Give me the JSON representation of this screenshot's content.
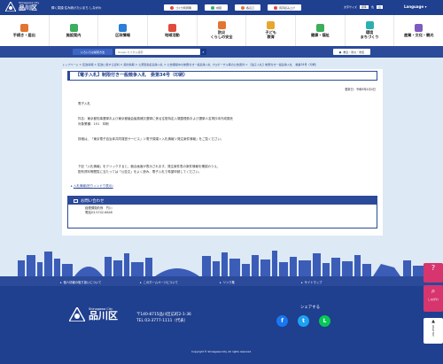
{
  "header": {
    "logo_sub": "Shinagawa City",
    "logo_main": "品川区",
    "tagline": "輝く笑顔 住み続けたいまち しながわ",
    "top_links": [
      {
        "label": "ゴミ分別辞典",
        "icon": "trash-icon",
        "color": "#e24a3b"
      },
      {
        "label": "地図",
        "icon": "map-icon",
        "color": "#3cae5c"
      },
      {
        "label": "各窓口",
        "icon": "counter-icon",
        "color": "#e2752f"
      },
      {
        "label": "音声読み上げ",
        "icon": "speaker-icon",
        "color": "#e24a3b"
      }
    ],
    "util": {
      "font_label": "文字サイズ",
      "font_value": "標準",
      "color_label": "色",
      "color_value": "白"
    },
    "language": "Language"
  },
  "nav": [
    {
      "label": "手続き・届出",
      "icon": "document-icon",
      "color": "#e2752f"
    },
    {
      "label": "施設案内",
      "icon": "facility-icon",
      "color": "#3cae5c"
    },
    {
      "label": "区政情報",
      "icon": "city-hall-icon",
      "color": "#2b7fd4"
    },
    {
      "label": "地域活動",
      "icon": "community-icon",
      "color": "#e24a3b"
    },
    {
      "label": "防災\nくらしの安全",
      "icon": "shield-icon",
      "color": "#e2752f"
    },
    {
      "label": "子ども\n教育",
      "icon": "child-icon",
      "color": "#e8a62d"
    },
    {
      "label": "健康・福祉",
      "icon": "health-icon",
      "color": "#3cae5c"
    },
    {
      "label": "環境\nまちづくり",
      "icon": "environment-icon",
      "color": "#2bb0b0"
    },
    {
      "label": "産業・文化・観光",
      "icon": "industry-icon",
      "color": "#7d5bbf"
    }
  ],
  "search": {
    "left_button": "いろいろな検索方法",
    "placeholder": "Google カスタム検索",
    "button_icon": "search-icon",
    "right_button": "救急・防災・防犯"
  },
  "breadcrumb": "トップページ > 区政情報 > 区政に関する資料 > 契約情報 > 公募型指名競争入札 > 公告期間中の制限付き一般競争入札 プロポーザル等の公告案件 > 【電子入札】制限付き一般競争入札　委第34号（印刷）",
  "page": {
    "title": "【電子入札】制限付き一般競争入札　委第34号（印刷）",
    "updated": "更新日：令和6年4月4日",
    "lines": [
      "電子入札",
      "件名：東京都知事選挙および東京都議会議員補欠選挙に係る往復特定入場整理券および選挙人名簿抄本作成委託",
      "対象業種：101　印刷",
      "詳細は、「東京電子自治体共同運営サービス」＞電子調達＞入札情報＞発注案件情報」をご覧ください。",
      "下記「入札情報」をクリックすると、競合画面が表示されます。発注案件表の案件情報を確認のうえ、",
      "配布資料等閲覧に当たっては「公告文」をよく読み、電子入札で希望申請してください。"
    ],
    "link_label": "入札情報(別ウィンドウ表示)",
    "inquiry_title": "お問い合わせ",
    "inquiry_lines": [
      "経理課契約係　竹川",
      "電話03-5742-6648"
    ]
  },
  "footer_links": [
    "個人情報の取り扱いについて",
    "このホームページについて",
    "リンク集",
    "サイトマップ"
  ],
  "footer": {
    "logo_sub": "Shinagawa City",
    "logo_main": "品川区",
    "address": "〒140-8715品川区広町2-1-36",
    "tel": "TEL 03-3777-1111（代表）",
    "share_label": "シェアする",
    "share": [
      {
        "name": "facebook-icon",
        "glyph": "f",
        "color": "#1877f2"
      },
      {
        "name": "twitter-icon",
        "glyph": "t",
        "color": "#1da1f2"
      },
      {
        "name": "line-icon",
        "glyph": "L",
        "color": "#06c755"
      }
    ],
    "copyright": "Copyright © Shinagawa City. All rights reserved."
  },
  "side": {
    "help_label": "しながわ",
    "pagetop_label": "PAGETOP"
  }
}
